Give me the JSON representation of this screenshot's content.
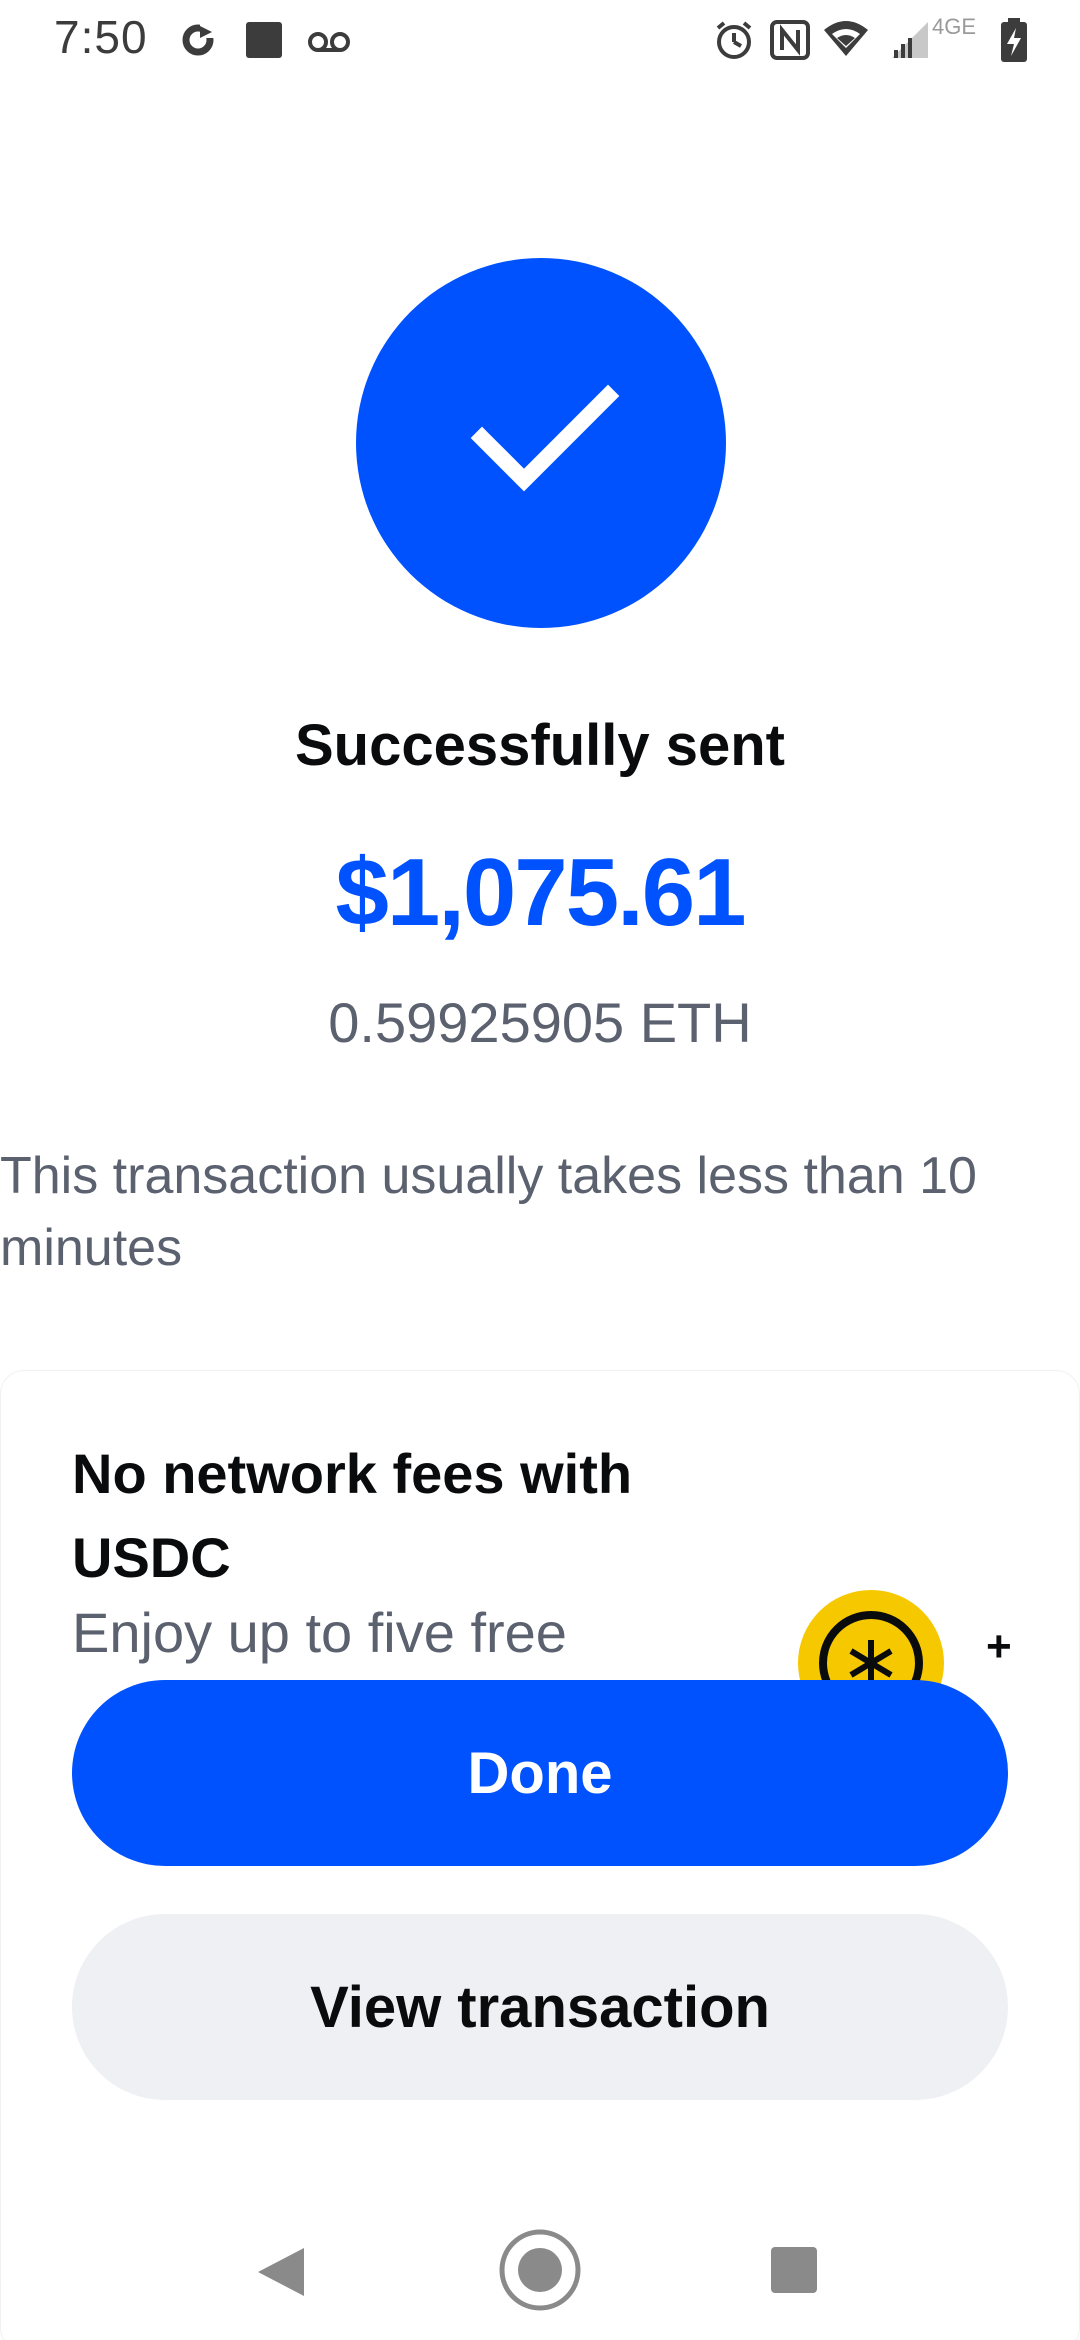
{
  "status_bar": {
    "time": "7:50",
    "left_icons": [
      "sync-icon",
      "square-notification-icon",
      "voicemail-icon"
    ],
    "right_icons": [
      "alarm-icon",
      "nfc-icon",
      "wifi-icon",
      "signal-icon",
      "battery-charging-icon"
    ],
    "network_label": "4GE"
  },
  "success": {
    "icon": "checkmark-icon",
    "title": "Successfully sent",
    "amount": "$1,075.61",
    "crypto_amount": "0.59925905 ETH",
    "info": "This transaction usually takes less than 10 minutes"
  },
  "promo": {
    "title": "No network fees with USDC",
    "subtitle": "Enjoy up to five free",
    "plus": "+"
  },
  "buttons": {
    "done": "Done",
    "view_transaction": "View transaction"
  },
  "nav": {
    "icons": [
      "back-icon",
      "home-icon",
      "recents-icon"
    ]
  },
  "colors": {
    "accent": "#0052ff",
    "text_primary": "#0a0b0d",
    "text_secondary": "#5b616e",
    "secondary_button": "#eef0f3",
    "coin_yellow": "#f5c800"
  }
}
